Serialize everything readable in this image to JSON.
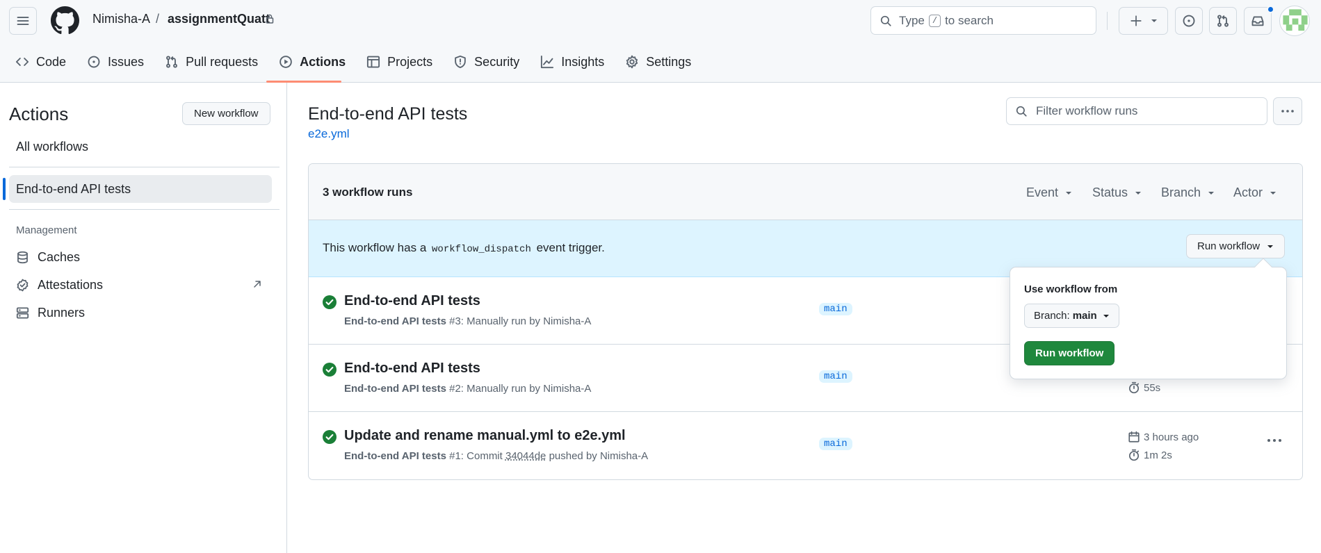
{
  "header": {
    "owner": "Nimisha-A",
    "separator": "/",
    "repo": "assignmentQuatt",
    "search": {
      "prefix": "Type",
      "key": "/",
      "suffix": "to search"
    }
  },
  "nav": {
    "tabs": [
      {
        "label": "Code",
        "icon": "code-icon"
      },
      {
        "label": "Issues",
        "icon": "issue-icon"
      },
      {
        "label": "Pull requests",
        "icon": "pull-request-icon"
      },
      {
        "label": "Actions",
        "icon": "play-icon",
        "selected": true
      },
      {
        "label": "Projects",
        "icon": "table-icon"
      },
      {
        "label": "Security",
        "icon": "shield-icon"
      },
      {
        "label": "Insights",
        "icon": "graph-icon"
      },
      {
        "label": "Settings",
        "icon": "gear-icon"
      }
    ]
  },
  "sidebar": {
    "title": "Actions",
    "new_workflow": "New workflow",
    "all_workflows": "All workflows",
    "active_workflow": "End-to-end API tests",
    "management_heading": "Management",
    "items": [
      {
        "label": "Caches",
        "icon": "database-icon"
      },
      {
        "label": "Attestations",
        "icon": "verified-icon"
      },
      {
        "label": "Runners",
        "icon": "server-icon"
      }
    ]
  },
  "main": {
    "title": "End-to-end API tests",
    "file": "e2e.yml",
    "filter_placeholder": "Filter workflow runs",
    "runs_count": "3 workflow runs",
    "filters": [
      "Event",
      "Status",
      "Branch",
      "Actor"
    ],
    "dispatch": {
      "before": "This workflow has a",
      "code": "workflow_dispatch",
      "after": "event trigger.",
      "button": "Run workflow"
    },
    "runs": [
      {
        "title": "End-to-end API tests",
        "workflow": "End-to-end API tests",
        "meta": "#3: Manually run by Nimisha-A",
        "branch": "main",
        "date": "",
        "duration": ""
      },
      {
        "title": "End-to-end API tests",
        "workflow": "End-to-end API tests",
        "meta": "#2: Manually run by Nimisha-A",
        "branch": "main",
        "date": "",
        "duration": "55s"
      },
      {
        "title": "Update and rename manual.yml to e2e.yml",
        "workflow": "End-to-end API tests",
        "meta_prefix": "#1: Commit",
        "commit": "34044de",
        "meta_suffix": "pushed by Nimisha-A",
        "branch": "main",
        "date": "3 hours ago",
        "duration": "1m 2s"
      }
    ]
  },
  "popover": {
    "label": "Use workflow from",
    "branch_prefix": "Branch:",
    "branch_value": "main",
    "run_button": "Run workflow"
  },
  "colors": {
    "accent": "#0969da",
    "success": "#1a7f37",
    "primary_button": "#1f883d",
    "nav_underline": "#fd8c73",
    "dispatch_bg": "#ddf4ff"
  }
}
